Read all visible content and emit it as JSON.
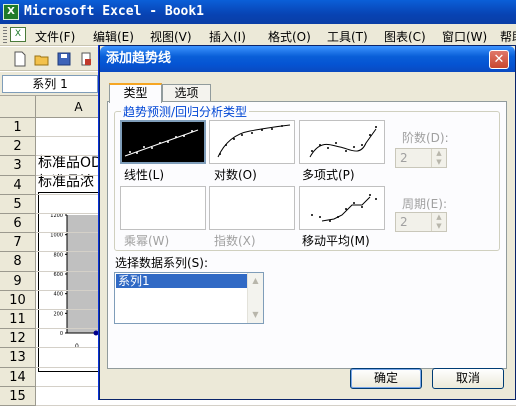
{
  "window": {
    "title": "Microsoft Excel - Book1"
  },
  "menu": [
    {
      "label": "文件(F)"
    },
    {
      "label": "编辑(E)"
    },
    {
      "label": "视图(V)"
    },
    {
      "label": "插入(I)"
    },
    {
      "label": "格式(O)"
    },
    {
      "label": "工具(T)"
    },
    {
      "label": "图表(C)"
    },
    {
      "label": "窗口(W)"
    },
    {
      "label": "帮助"
    }
  ],
  "namebox": {
    "value": "系列 1"
  },
  "grid": {
    "column_header": "A",
    "rows": [
      "1",
      "2",
      "3",
      "4",
      "5",
      "6",
      "7",
      "8",
      "9",
      "10",
      "11",
      "12",
      "13",
      "14",
      "15"
    ],
    "cells": {
      "a3": "标准品OD",
      "a4": "标准品浓"
    }
  },
  "chart": {
    "yticks": [
      "1200",
      "1000",
      "800",
      "600",
      "400",
      "200",
      "0"
    ],
    "xtick": "0"
  },
  "dialog": {
    "title": "添加趋势线",
    "close_symbol": "✕",
    "tabs": [
      {
        "label": "类型"
      },
      {
        "label": "选项"
      }
    ],
    "group_label": "趋势预测/回归分析类型",
    "types": [
      {
        "label": "线性(L)",
        "enabled": true,
        "selected": true
      },
      {
        "label": "对数(O)",
        "enabled": true
      },
      {
        "label": "多项式(P)",
        "enabled": true
      },
      {
        "label": "乘幂(W)",
        "enabled": false
      },
      {
        "label": "指数(X)",
        "enabled": false
      },
      {
        "label": "移动平均(M)",
        "enabled": true
      }
    ],
    "order": {
      "label": "阶数(D):",
      "value": "2"
    },
    "period": {
      "label": "周期(E):",
      "value": "2"
    },
    "series_label": "选择数据系列(S):",
    "series": [
      "系列1"
    ],
    "ok_label": "确定",
    "cancel_label": "取消"
  },
  "colors": {
    "title_blue": "#0a5fd8",
    "selection": "#316ac5",
    "group_label": "#0046d5"
  }
}
